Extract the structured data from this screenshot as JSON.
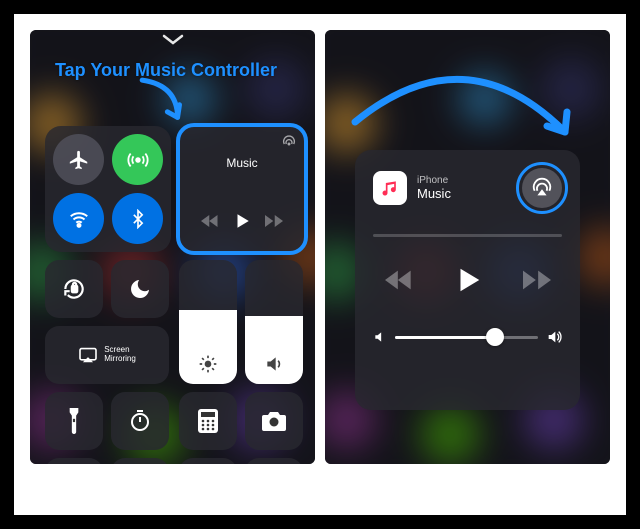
{
  "left": {
    "annotation": "Tap Your Music Controller",
    "music": {
      "title": "Music"
    },
    "screen_mirroring_label": "Screen\nMirroring",
    "brightness_percent": 60,
    "volume_percent": 55
  },
  "right": {
    "source_label": "iPhone",
    "app_label": "Music",
    "volume_percent": 70
  },
  "colors": {
    "accent": "#1e90ff",
    "green": "#34c759",
    "blue": "#0071e3"
  }
}
